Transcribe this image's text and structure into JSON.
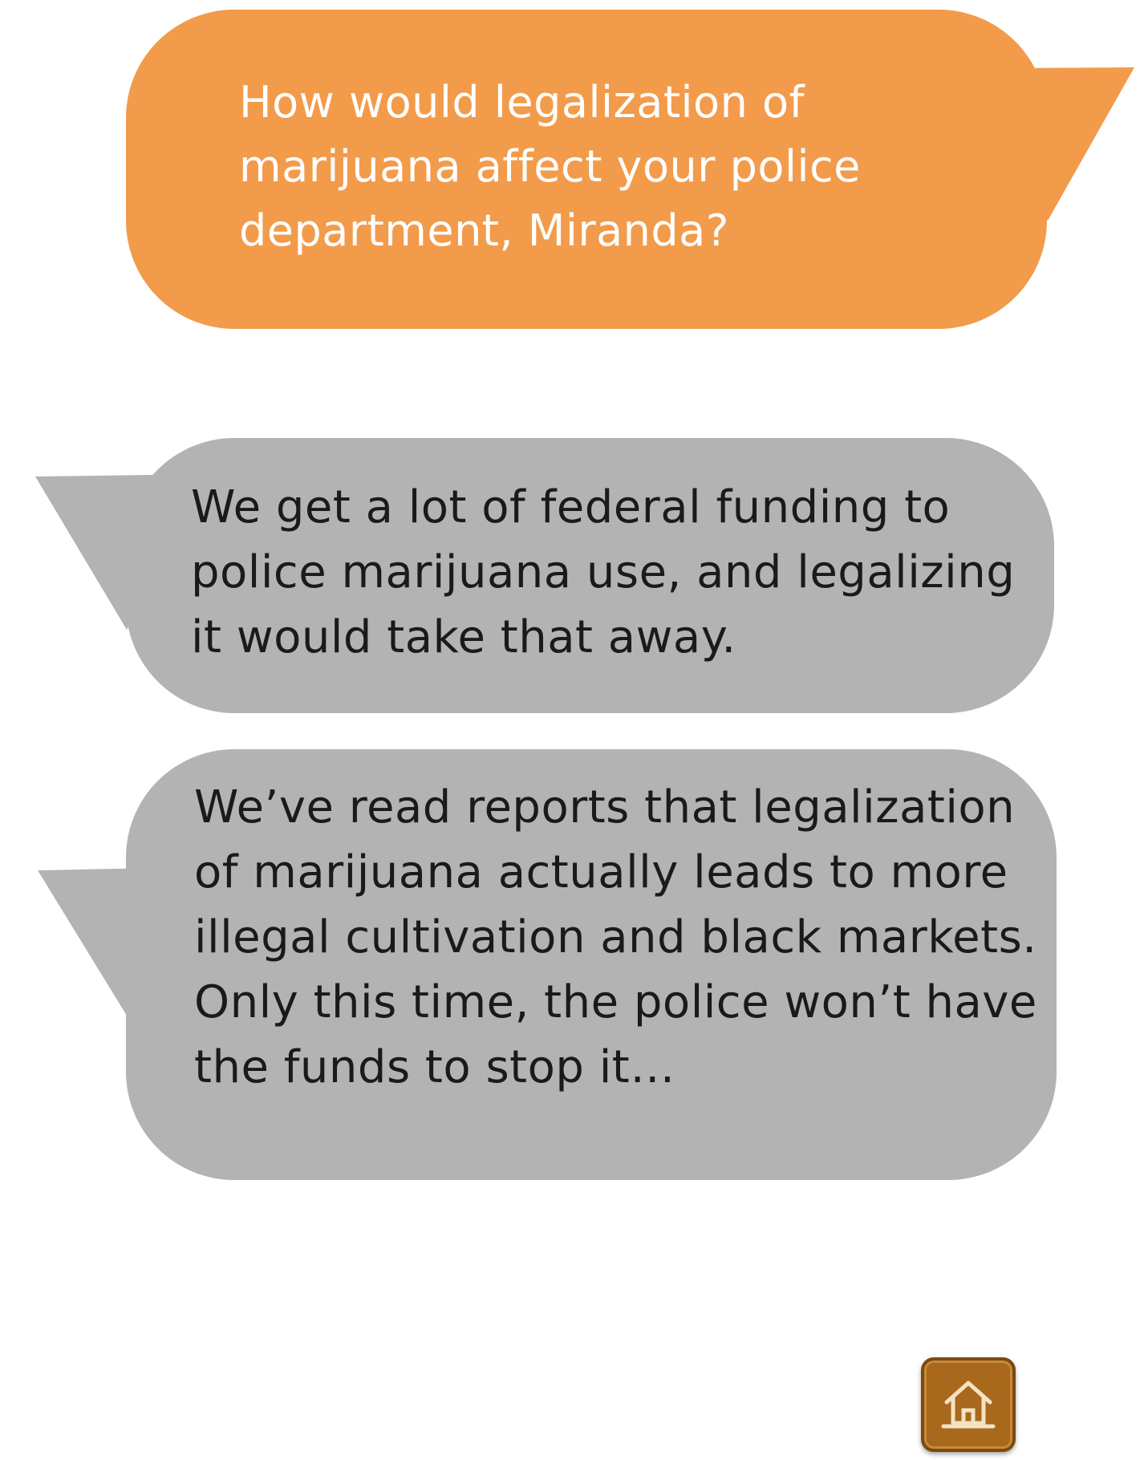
{
  "colors": {
    "question_bubble": "#f29b4b",
    "answer_bubble": "#b3b3b3",
    "question_text": "#ffffff",
    "answer_text": "#1a1a1a",
    "home_button": "#a9691d",
    "home_icon": "#f3e3c3"
  },
  "conversation": {
    "question": "How would legalization of marijuana affect your police department, Miranda?",
    "responses": [
      "We get a lot of federal funding to police marijuana use, and legalizing it would take that away.",
      "We’ve read reports that legalization of marijuana actually leads to more illegal cultivation and black markets. Only this time, the police won’t have the funds to stop it…"
    ]
  },
  "navigation": {
    "home_icon": "home-icon"
  }
}
